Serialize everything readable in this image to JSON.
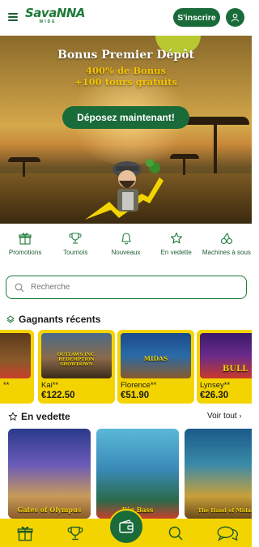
{
  "header": {
    "logo_main": "SavaNNA",
    "logo_sub": "WIDE",
    "signup_label": "S'inscrire"
  },
  "hero": {
    "title": "Bonus Premier Dépôt",
    "offer_line1": "400% de Bonus",
    "offer_line2": "+100 tours gratuits",
    "cta_label": "Déposez maintenant!"
  },
  "categories": [
    {
      "label": "Promotions",
      "icon": "gift-icon"
    },
    {
      "label": "Tournois",
      "icon": "trophy-icon"
    },
    {
      "label": "Nouveaux",
      "icon": "bell-icon"
    },
    {
      "label": "En vedette",
      "icon": "star-icon"
    },
    {
      "label": "Machines à sous",
      "icon": "cherry-icon"
    }
  ],
  "search": {
    "placeholder": "Recherche"
  },
  "winners": {
    "title": "Gagnants récents",
    "items": [
      {
        "name": "**",
        "amount": "",
        "game": ""
      },
      {
        "name": "Kai**",
        "amount": "€122.50",
        "game": "OUTLAWS INC. REDEMPTION SHOWDOWN"
      },
      {
        "name": "Florence**",
        "amount": "€51.90",
        "game": "MIDAS"
      },
      {
        "name": "Lynsey**",
        "amount": "€26.30",
        "game": "BULL"
      }
    ]
  },
  "featured": {
    "title": "En vedette",
    "see_all": "Voir tout",
    "items": [
      {
        "game": "Gates of Olympus"
      },
      {
        "game": "Big Bass"
      },
      {
        "game": "The Hand of Midas"
      }
    ]
  },
  "bottom_nav": [
    {
      "icon": "gift-icon"
    },
    {
      "icon": "trophy-icon"
    },
    {
      "icon": "wallet-icon"
    },
    {
      "icon": "search-icon"
    },
    {
      "icon": "chat-icon"
    }
  ],
  "colors": {
    "brand_green": "#1a6b3a",
    "accent_yellow": "#f4d400"
  }
}
